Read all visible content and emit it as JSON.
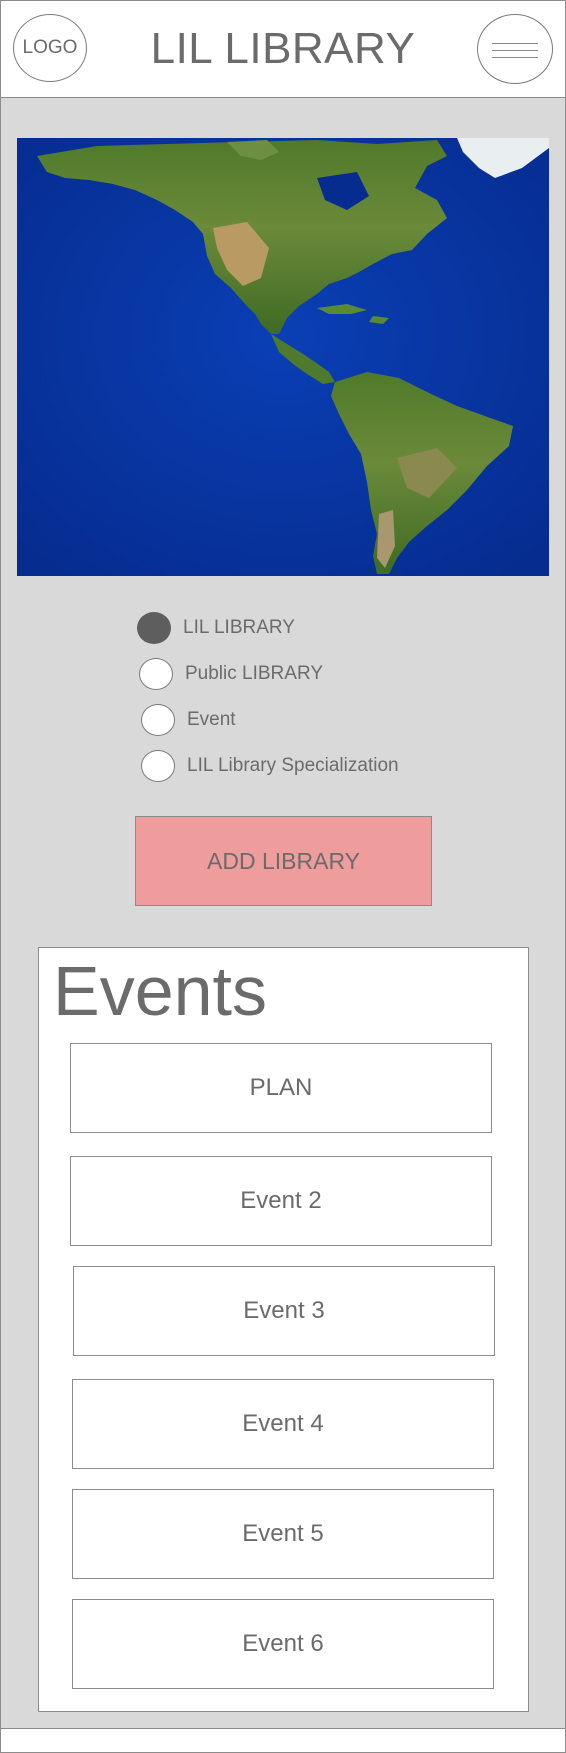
{
  "header": {
    "logo_label": "LOGO",
    "title": "LIL LIBRARY",
    "menu_icon": "hamburger-menu-icon"
  },
  "map": {
    "description_icon": "world-map-americas"
  },
  "filters": [
    {
      "label": "LIL LIBRARY",
      "checked": true
    },
    {
      "label": "Public LIBRARY",
      "checked": false
    },
    {
      "label": "Event",
      "checked": false
    },
    {
      "label": "LIL Library Specialization",
      "checked": false
    }
  ],
  "add_button": {
    "label": "ADD LIBRARY",
    "color": "#ef9c9d"
  },
  "events": {
    "title": "Events",
    "items": [
      {
        "label": "PLAN"
      },
      {
        "label": "Event 2"
      },
      {
        "label": "Event 3"
      },
      {
        "label": "Event 4"
      },
      {
        "label": "Event 5"
      },
      {
        "label": "Event 6"
      }
    ]
  }
}
